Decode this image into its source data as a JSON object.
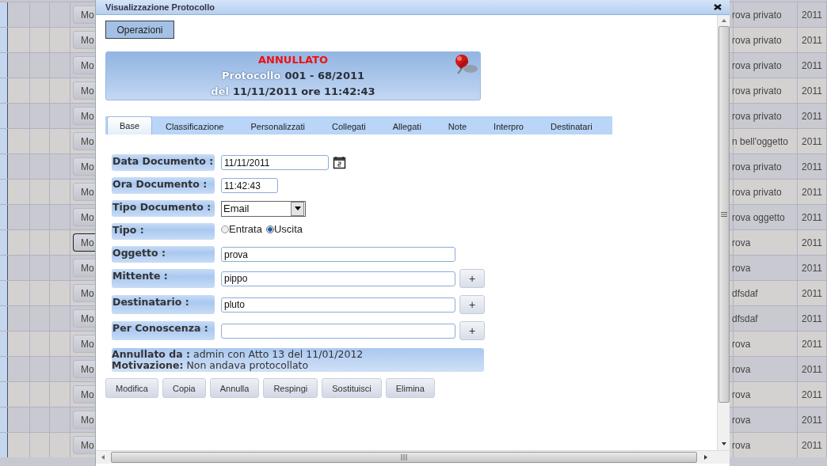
{
  "background_table": {
    "rows": [
      {
        "button": "Mo",
        "focused": false,
        "object": "rova privato",
        "year": "2011"
      },
      {
        "button": "Mo",
        "focused": false,
        "object": "rova privato",
        "year": "2011"
      },
      {
        "button": "Mo",
        "focused": false,
        "object": "rova privato",
        "year": "2011"
      },
      {
        "button": "Mo",
        "focused": false,
        "object": "rova privato",
        "year": "2011"
      },
      {
        "button": "Mo",
        "focused": false,
        "object": "rova privato",
        "year": "2011"
      },
      {
        "button": "Mo",
        "focused": false,
        "object": "n bell'oggetto",
        "year": "2011"
      },
      {
        "button": "Mo",
        "focused": false,
        "object": "rova privato",
        "year": "2011"
      },
      {
        "button": "Mo",
        "focused": false,
        "object": "rova privato",
        "year": "2011"
      },
      {
        "button": "Mo",
        "focused": false,
        "object": "rova oggetto",
        "year": "2011"
      },
      {
        "button": "Mo",
        "focused": true,
        "object": "rova",
        "year": "2011"
      },
      {
        "button": "Mo",
        "focused": false,
        "object": "rova",
        "year": "2011"
      },
      {
        "button": "Mo",
        "focused": false,
        "object": "dfsdaf",
        "year": "2011"
      },
      {
        "button": "Mo",
        "focused": false,
        "object": "dfsdaf",
        "year": "2011"
      },
      {
        "button": "Mo",
        "focused": false,
        "object": "rova",
        "year": "2011"
      },
      {
        "button": "Mo",
        "focused": false,
        "object": "rova",
        "year": "2011"
      },
      {
        "button": "Mo",
        "focused": false,
        "object": "rova",
        "year": "2011"
      },
      {
        "button": "Mo",
        "focused": false,
        "object": "rova",
        "year": "2011"
      },
      {
        "button": "Mo",
        "focused": false,
        "object": "rova",
        "year": "2011"
      }
    ]
  },
  "dialog": {
    "title": "Visualizzazione Protocollo",
    "operations_button": "Operazioni",
    "header": {
      "status": "ANNULLATO",
      "protocol_label": "Protocollo",
      "protocol_number": "001 - 68/2011",
      "date_label": "del",
      "date_value": "11/11/2011 ore 11:42:43"
    },
    "tabs": [
      {
        "label": "Base",
        "selected": true
      },
      {
        "label": "Classificazione",
        "selected": false
      },
      {
        "label": "Personalizzati",
        "selected": false
      },
      {
        "label": "Collegati",
        "selected": false
      },
      {
        "label": "Allegati",
        "selected": false
      },
      {
        "label": "Note",
        "selected": false
      },
      {
        "label": "Interpro",
        "selected": false
      },
      {
        "label": "Destinatari",
        "selected": false
      }
    ],
    "fields": [
      {
        "kind": "date",
        "label": "Data Documento :",
        "value": "11/11/2011"
      },
      {
        "kind": "time",
        "label": "Ora Documento :",
        "value": "11:42:43"
      },
      {
        "kind": "select",
        "label": "Tipo Documento :",
        "value": "Email"
      },
      {
        "kind": "radio",
        "label": "Tipo :",
        "options": [
          {
            "label": "Entrata",
            "selected": false
          },
          {
            "label": "Uscita",
            "selected": true
          }
        ]
      },
      {
        "kind": "text",
        "label": "Oggetto :",
        "value": "prova"
      },
      {
        "kind": "text_add",
        "label": "Mittente :",
        "value": "pippo",
        "button": "+"
      },
      {
        "kind": "text_add",
        "label": "Destinatario :",
        "value": "pluto",
        "button": "+"
      },
      {
        "kind": "text_add",
        "label": "Per Conoscenza :",
        "button": "+"
      }
    ],
    "cancellation": {
      "line_1": "**Annullato da :** admin con Atto 13 del 11/01/2012",
      "line_2": "**Motivazione:** Non andava protocollato"
    },
    "buttons": [
      "Modifica",
      "Copia",
      "Annulla",
      "Respingi",
      "Sostituisci",
      "Elimina"
    ]
  }
}
